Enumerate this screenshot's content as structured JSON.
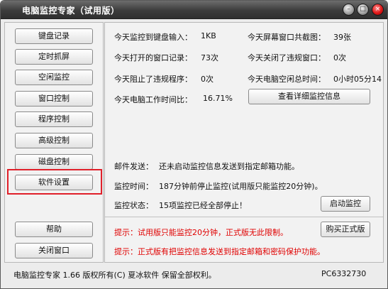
{
  "window": {
    "title": "电脑监控专家（试用版）"
  },
  "nav": {
    "items": [
      {
        "label": "键盘记录"
      },
      {
        "label": "定时抓屏"
      },
      {
        "label": "空闲监控"
      },
      {
        "label": "窗口控制"
      },
      {
        "label": "程序控制"
      },
      {
        "label": "高级控制"
      },
      {
        "label": "磁盘控制"
      },
      {
        "label": "软件设置"
      }
    ],
    "help_label": "帮助",
    "close_label": "关闭窗口"
  },
  "stats": {
    "keyboard_label": "今天监控到键盘输入：",
    "keyboard_value": "1KB",
    "screenshots_label": "今天屏幕窗口共截图：",
    "screenshots_value": "39张",
    "windows_opened_label": "今天打开的窗口记录：",
    "windows_opened_value": "73次",
    "windows_closed_label": "今天关闭了违规窗口：",
    "windows_closed_value": "0次",
    "programs_blocked_label": "今天阻止了违规程序：",
    "programs_blocked_value": "0次",
    "idle_label": "今天电脑空闲总时间：",
    "idle_value": "0小时05分14",
    "work_ratio_label": "今天电脑工作时间比：",
    "work_ratio_value": "16.71%",
    "details_button": "查看详细监控信息"
  },
  "info": {
    "mail_label": "邮件发送：",
    "mail_value": "还未启动监控信息发送到指定邮箱功能。",
    "time_label": "监控时间：",
    "time_value": "187分钟前停止监控(试用版只能监控20分钟)。",
    "status_label": "监控状态：",
    "status_value": "15项监控已经全部停止！",
    "start_button": "启动监控"
  },
  "tips": {
    "tip1": "提示：试用版只能监控20分钟，正式版无此限制。",
    "tip2": "提示：正式版有把监控信息发送到指定邮箱和密码保护功能。",
    "buy_button": "购买正式版"
  },
  "status_bar": {
    "product": "电脑监控专家 1.66 版权所有(C) 夏冰软件 保留全部权利。",
    "pc_name": "PC6332730"
  },
  "colors": {
    "tip_text": "#e00000",
    "highlight_border": "#e0202a"
  }
}
